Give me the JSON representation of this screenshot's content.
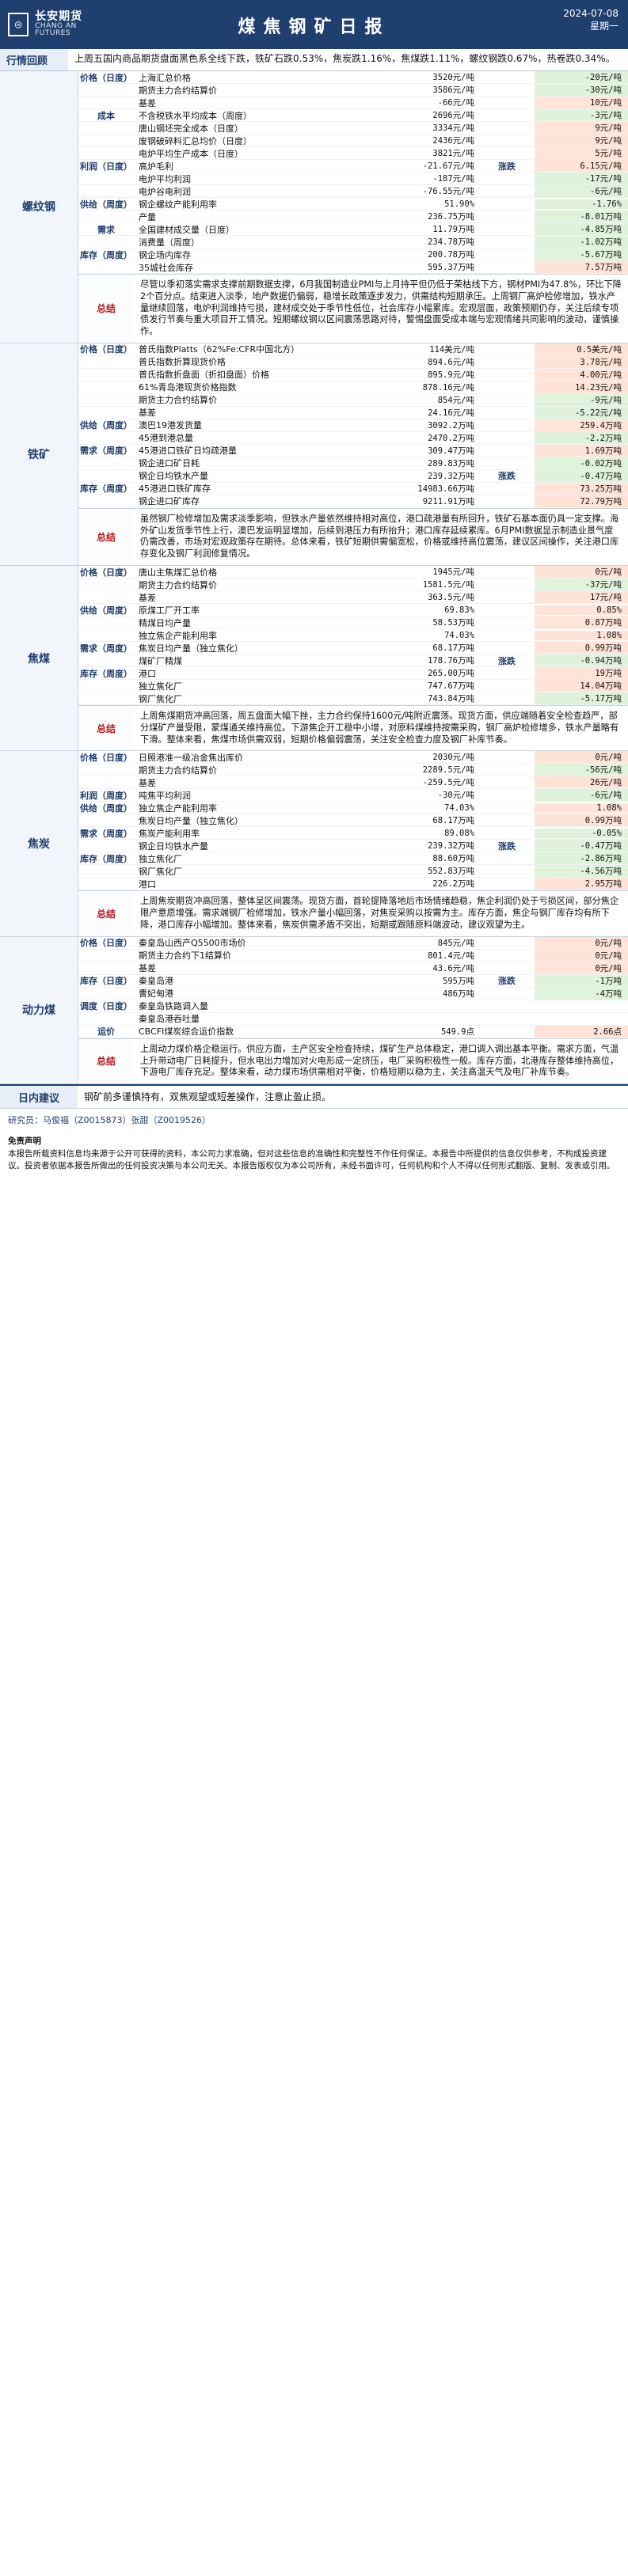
{
  "header": {
    "company_cn": "长安期货",
    "company_en": "CHANG AN FUTURES",
    "title": "煤焦钢矿日报",
    "date": "2024-07-08",
    "weekday": "星期一"
  },
  "market_review": {
    "label": "行情回顾",
    "text": "上周五国内商品期货盘面黑色系全线下跌，铁矿石跌0.53%，焦炭跌1.16%，焦煤跌1.11%，螺纹钢跌0.67%，热卷跌0.34%。"
  },
  "sections": [
    {
      "name": "螺纹钢",
      "rows": [
        {
          "cat": "价格（日度）",
          "ind": "上海汇总价格",
          "val": "3520元/吨",
          "trend": "",
          "chg": "-20元/吨",
          "dir": "neg"
        },
        {
          "cat": "",
          "ind": "期货主力合约结算价",
          "val": "3586元/吨",
          "trend": "",
          "chg": "-30元/吨",
          "dir": "neg"
        },
        {
          "cat": "",
          "ind": "基差",
          "val": "-66元/吨",
          "trend": "",
          "chg": "10元/吨",
          "dir": "pos"
        },
        {
          "cat": "成本",
          "ind": "不含税铁水平均成本（周度）",
          "val": "2696元/吨",
          "trend": "",
          "chg": "-3元/吨",
          "dir": "neg"
        },
        {
          "cat": "",
          "ind": "唐山钢坯完全成本（日度）",
          "val": "3334元/吨",
          "trend": "",
          "chg": "9元/吨",
          "dir": "pos"
        },
        {
          "cat": "",
          "ind": "废钢破碎料汇总均价（日度）",
          "val": "2436元/吨",
          "trend": "",
          "chg": "9元/吨",
          "dir": "pos"
        },
        {
          "cat": "",
          "ind": "电炉平均生产成本（日度）",
          "val": "3821元/吨",
          "trend": "",
          "chg": "5元/吨",
          "dir": "pos"
        },
        {
          "cat": "利润（日度）",
          "ind": "高炉毛利",
          "val": "-21.67元/吨",
          "trend": "涨跌",
          "chg": "6.15元/吨",
          "dir": "pos"
        },
        {
          "cat": "",
          "ind": "电炉平均利润",
          "val": "-187元/吨",
          "trend": "",
          "chg": "-17元/吨",
          "dir": "neg"
        },
        {
          "cat": "",
          "ind": "电炉谷电利润",
          "val": "-76.55元/吨",
          "trend": "",
          "chg": "-6元/吨",
          "dir": "neg"
        },
        {
          "cat": "供给（周度）",
          "ind": "钢企螺纹产能利用率",
          "val": "51.90%",
          "trend": "",
          "chg": "-1.76%",
          "dir": "neg"
        },
        {
          "cat": "",
          "ind": "产量",
          "val": "236.75万吨",
          "trend": "",
          "chg": "-8.01万吨",
          "dir": "neg"
        },
        {
          "cat": "需求",
          "ind": "全国建材成交量（日度）",
          "val": "11.79万吨",
          "trend": "",
          "chg": "-4.85万吨",
          "dir": "neg"
        },
        {
          "cat": "",
          "ind": "消费量（周度）",
          "val": "234.78万吨",
          "trend": "",
          "chg": "-1.02万吨",
          "dir": "neg"
        },
        {
          "cat": "库存（周度）",
          "ind": "钢企场内库存",
          "val": "200.78万吨",
          "trend": "",
          "chg": "-5.67万吨",
          "dir": "neg"
        },
        {
          "cat": "",
          "ind": "35城社会库存",
          "val": "595.37万吨",
          "trend": "",
          "chg": "7.57万吨",
          "dir": "pos"
        }
      ],
      "summary_label": "总结",
      "summary": "尽管以季初落实需求支撑前期数据支撑，6月我国制造业PMI与上月持平但仍低于荣枯线下方，钢材PMI为47.8%，环比下降2个百分点。结束进入淡季，地产数据仍偏弱，稳增长政策逐步发力，供需结构短期承压。上周钢厂高炉检修增加，铁水产量继续回落，电炉利润维持亏损，建材成交处于季节性低位，社会库存小幅累库。宏观层面，政策预期仍存，关注后续专项债发行节奏与重大项目开工情况。短期螺纹钢以区间震荡思路对待，警惕盘面受成本端与宏观情绪共同影响的波动，谨慎操作。"
    },
    {
      "name": "铁矿",
      "rows": [
        {
          "cat": "价格（日度）",
          "ind": "普氏指数Platts（62%Fe:CFR中国北方）",
          "val": "114美元/吨",
          "trend": "",
          "chg": "0.5美元/吨",
          "dir": "pos"
        },
        {
          "cat": "",
          "ind": "普氏指数折算现货价格",
          "val": "894.6元/吨",
          "trend": "",
          "chg": "3.78元/吨",
          "dir": "pos"
        },
        {
          "cat": "",
          "ind": "普氏指数折盘面（折扣盘面）价格",
          "val": "895.9元/吨",
          "trend": "",
          "chg": "4.00元/吨",
          "dir": "pos"
        },
        {
          "cat": "",
          "ind": "61%青岛港现货价格指数",
          "val": "878.16元/吨",
          "trend": "",
          "chg": "14.23元/吨",
          "dir": "pos"
        },
        {
          "cat": "",
          "ind": "期货主力合约结算价",
          "val": "854元/吨",
          "trend": "",
          "chg": "-9元/吨",
          "dir": "neg"
        },
        {
          "cat": "",
          "ind": "基差",
          "val": "24.16元/吨",
          "trend": "",
          "chg": "-5.22元/吨",
          "dir": "neg"
        },
        {
          "cat": "供给（周度）",
          "ind": "澳巴19港发货量",
          "val": "3092.2万吨",
          "trend": "",
          "chg": "259.4万吨",
          "dir": "pos"
        },
        {
          "cat": "",
          "ind": "45港到港总量",
          "val": "2470.2万吨",
          "trend": "",
          "chg": "-2.2万吨",
          "dir": "neg"
        },
        {
          "cat": "需求（周度）",
          "ind": "45港进口铁矿日均疏港量",
          "val": "309.47万吨",
          "trend": "",
          "chg": "1.69万吨",
          "dir": "pos"
        },
        {
          "cat": "",
          "ind": "钢企进口矿日耗",
          "val": "289.83万吨",
          "trend": "",
          "chg": "-0.02万吨",
          "dir": "neg"
        },
        {
          "cat": "",
          "ind": "钢企日均铁水产量",
          "val": "239.32万吨",
          "trend": "涨跌",
          "chg": "-0.47万吨",
          "dir": "neg"
        },
        {
          "cat": "库存（周度）",
          "ind": "45港进口铁矿库存",
          "val": "14983.66万吨",
          "trend": "",
          "chg": "73.25万吨",
          "dir": "pos"
        },
        {
          "cat": "",
          "ind": "钢企进口矿库存",
          "val": "9211.91万吨",
          "trend": "",
          "chg": "72.79万吨",
          "dir": "pos"
        }
      ],
      "summary_label": "总结",
      "summary": "虽然钢厂检修增加及需求淡季影响，但铁水产量依然维持相对高位，港口疏港量有所回升，铁矿石基本面仍具一定支撑。海外矿山发货季节性上行，澳巴发运明显增加，后续到港压力有所抬升；港口库存延续累库。6月PMI数据显示制造业景气度仍需改善，市场对宏观政策存在期待。总体来看，铁矿短期供需偏宽松，价格或维持高位震荡，建议区间操作，关注港口库存变化及钢厂利润修复情况。"
    },
    {
      "name": "焦煤",
      "rows": [
        {
          "cat": "价格（日度）",
          "ind": "唐山主焦煤汇总价格",
          "val": "1945元/吨",
          "trend": "",
          "chg": "0元/吨",
          "dir": "pos"
        },
        {
          "cat": "",
          "ind": "期货主力合约结算价",
          "val": "1581.5元/吨",
          "trend": "",
          "chg": "-37元/吨",
          "dir": "neg"
        },
        {
          "cat": "",
          "ind": "基差",
          "val": "363.5元/吨",
          "trend": "",
          "chg": "17元/吨",
          "dir": "pos"
        },
        {
          "cat": "供给（周度）",
          "ind": "原煤工厂开工率",
          "val": "69.83%",
          "trend": "",
          "chg": "0.85%",
          "dir": "pos"
        },
        {
          "cat": "",
          "ind": "精煤日均产量",
          "val": "58.53万吨",
          "trend": "",
          "chg": "0.87万吨",
          "dir": "pos"
        },
        {
          "cat": "",
          "ind": "独立焦企产能利用率",
          "val": "74.03%",
          "trend": "",
          "chg": "1.08%",
          "dir": "pos"
        },
        {
          "cat": "需求（周度）",
          "ind": "焦炭日均产量（独立焦化）",
          "val": "68.17万吨",
          "trend": "",
          "chg": "0.99万吨",
          "dir": "pos"
        },
        {
          "cat": "",
          "ind": "煤矿厂精煤",
          "val": "178.76万吨",
          "trend": "涨跌",
          "chg": "-0.94万吨",
          "dir": "neg"
        },
        {
          "cat": "库存（周度）",
          "ind": "港口",
          "val": "265.00万吨",
          "trend": "",
          "chg": "19万吨",
          "dir": "pos"
        },
        {
          "cat": "",
          "ind": "独立焦化厂",
          "val": "747.67万吨",
          "trend": "",
          "chg": "14.04万吨",
          "dir": "pos"
        },
        {
          "cat": "",
          "ind": "钢厂焦化厂",
          "val": "743.84万吨",
          "trend": "",
          "chg": "-5.17万吨",
          "dir": "neg"
        }
      ],
      "summary_label": "总结",
      "summary": "上周焦煤期货冲高回落，周五盘面大幅下挫，主力合约保持1600元/吨附近震荡。现货方面，供应端随着安全检查趋严，部分煤矿产量受限，蒙煤通关维持高位。下游焦企开工稳中小增，对原料煤维持按需采购，钢厂高炉检修增多，铁水产量略有下滑。整体来看，焦煤市场供需双弱，短期价格偏弱震荡，关注安全检查力度及钢厂补库节奏。"
    },
    {
      "name": "焦炭",
      "rows": [
        {
          "cat": "价格（日度）",
          "ind": "日照港准一级冶金焦出库价",
          "val": "2030元/吨",
          "trend": "",
          "chg": "0元/吨",
          "dir": "pos"
        },
        {
          "cat": "",
          "ind": "期货主力合约结算价",
          "val": "2289.5元/吨",
          "trend": "",
          "chg": "-56元/吨",
          "dir": "neg"
        },
        {
          "cat": "",
          "ind": "基差",
          "val": "-259.5元/吨",
          "trend": "",
          "chg": "26元/吨",
          "dir": "pos"
        },
        {
          "cat": "利润（周度）",
          "ind": "吨焦平均利润",
          "val": "-30元/吨",
          "trend": "",
          "chg": "-6元/吨",
          "dir": "neg"
        },
        {
          "cat": "供给（周度）",
          "ind": "独立焦企产能利用率",
          "val": "74.03%",
          "trend": "",
          "chg": "1.08%",
          "dir": "pos"
        },
        {
          "cat": "",
          "ind": "焦炭日均产量（独立焦化）",
          "val": "68.17万吨",
          "trend": "",
          "chg": "0.99万吨",
          "dir": "pos"
        },
        {
          "cat": "需求（周度）",
          "ind": "焦炭产能利用率",
          "val": "89.08%",
          "trend": "",
          "chg": "-0.05%",
          "dir": "neg"
        },
        {
          "cat": "",
          "ind": "钢企日均铁水产量",
          "val": "239.32万吨",
          "trend": "涨跌",
          "chg": "-0.47万吨",
          "dir": "neg"
        },
        {
          "cat": "库存（周度）",
          "ind": "独立焦化厂",
          "val": "88.60万吨",
          "trend": "",
          "chg": "-2.86万吨",
          "dir": "neg"
        },
        {
          "cat": "",
          "ind": "钢厂焦化厂",
          "val": "552.83万吨",
          "trend": "",
          "chg": "-4.56万吨",
          "dir": "neg"
        },
        {
          "cat": "",
          "ind": "港口",
          "val": "226.2万吨",
          "trend": "",
          "chg": "2.95万吨",
          "dir": "pos"
        }
      ],
      "summary_label": "总结",
      "summary": "上周焦炭期货冲高回落，整体呈区间震荡。现货方面，首轮提降落地后市场情绪趋稳，焦企利润仍处于亏损区间，部分焦企限产意愿增强。需求端钢厂检修增加，铁水产量小幅回落，对焦炭采购以按需为主。库存方面，焦企与钢厂库存均有所下降，港口库存小幅增加。整体来看，焦炭供需矛盾不突出，短期或跟随原料端波动，建议观望为主。"
    },
    {
      "name": "动力煤",
      "rows": [
        {
          "cat": "价格（日度）",
          "ind": "秦皇岛山西产Q5500市场价",
          "val": "845元/吨",
          "trend": "",
          "chg": "0元/吨",
          "dir": "pos"
        },
        {
          "cat": "",
          "ind": "期货主力合约下1结算价",
          "val": "801.4元/吨",
          "trend": "",
          "chg": "0元/吨",
          "dir": "pos"
        },
        {
          "cat": "",
          "ind": "基差",
          "val": "43.6元/吨",
          "trend": "",
          "chg": "0元/吨",
          "dir": "pos"
        },
        {
          "cat": "库存（日度）",
          "ind": "秦皇岛港",
          "val": "595万吨",
          "trend": "涨跌",
          "chg": "-1万吨",
          "dir": "neg"
        },
        {
          "cat": "",
          "ind": "曹妃甸港",
          "val": "486万吨",
          "trend": "",
          "chg": "-4万吨",
          "dir": "neg"
        },
        {
          "cat": "调度（日度）",
          "ind": "秦皇岛铁路调入量",
          "val": "",
          "trend": "",
          "chg": "",
          "dir": ""
        },
        {
          "cat": "",
          "ind": "秦皇岛港吞吐量",
          "val": "",
          "trend": "",
          "chg": "",
          "dir": ""
        },
        {
          "cat": "运价",
          "ind": "CBCFI煤炭综合运价指数",
          "val": "549.9点",
          "trend": "",
          "chg": "2.66点",
          "dir": "pos"
        }
      ],
      "summary_label": "总结",
      "summary": "上周动力煤价格企稳运行。供应方面，主产区安全检查持续，煤矿生产总体稳定，港口调入调出基本平衡。需求方面，气温上升带动电厂日耗提升，但水电出力增加对火电形成一定挤压，电厂采购积极性一般。库存方面，北港库存整体维持高位，下游电厂库存充足。整体来看，动力煤市场供需相对平衡，价格短期以稳为主，关注高温天气及电厂补库节奏。"
    }
  ],
  "advice": {
    "label": "日内建议",
    "text": "钢矿前多谨慎持有，双焦观望或短差操作，注意止盈止损。"
  },
  "analyst": "研究员：马俊福（Z0015873）张甜（Z0019526）",
  "disclaimer": {
    "title": "免责声明",
    "text": "本报告所载资料信息均来源于公开可获得的资料，本公司力求准确，但对这些信息的准确性和完整性不作任何保证。本报告中所提供的信息仅供参考，不构成投资建议。投资者依据本报告所做出的任何投资决策与本公司无关。本报告版权仅为本公司所有，未经书面许可，任何机构和个人不得以任何形式翻版、复制、发表或引用。"
  },
  "colors": {
    "brand": "#1f3f6f",
    "pos_bg": "#ffe3d6",
    "neg_bg": "#dff2da"
  }
}
